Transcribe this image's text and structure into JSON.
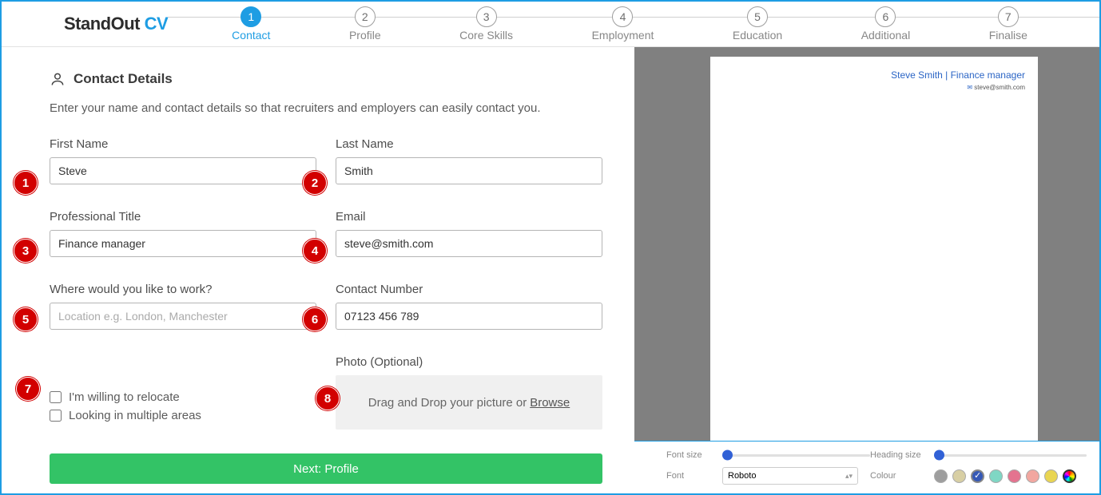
{
  "logo": {
    "part1": "StandOut ",
    "part2": "CV"
  },
  "steps": [
    {
      "num": "1",
      "label": "Contact",
      "active": true
    },
    {
      "num": "2",
      "label": "Profile"
    },
    {
      "num": "3",
      "label": "Core Skills"
    },
    {
      "num": "4",
      "label": "Employment"
    },
    {
      "num": "5",
      "label": "Education"
    },
    {
      "num": "6",
      "label": "Additional"
    },
    {
      "num": "7",
      "label": "Finalise"
    }
  ],
  "section": {
    "title": "Contact Details",
    "desc": "Enter your name and contact details so that recruiters and employers can easily contact you."
  },
  "fields": {
    "first_name": {
      "label": "First Name",
      "value": "Steve"
    },
    "last_name": {
      "label": "Last Name",
      "value": "Smith"
    },
    "title": {
      "label": "Professional Title",
      "value": "Finance manager"
    },
    "email": {
      "label": "Email",
      "value": "steve@smith.com"
    },
    "location": {
      "label": "Where would you like to work?",
      "placeholder": "Location e.g. London, Manchester",
      "value": ""
    },
    "phone": {
      "label": "Contact Number",
      "value": "07123 456 789"
    }
  },
  "checks": {
    "relocate": "I'm willing to relocate",
    "multiple": "Looking in multiple areas"
  },
  "photo": {
    "label": "Photo (Optional)",
    "drop_text": "Drag and Drop your picture or ",
    "browse": "Browse"
  },
  "next_button": "Next: Profile",
  "badges": [
    "1",
    "2",
    "3",
    "4",
    "5",
    "6",
    "7",
    "8"
  ],
  "preview": {
    "name_title": "Steve Smith | Finance manager",
    "email": "steve@smith.com"
  },
  "style_panel": {
    "font_size_label": "Font size",
    "heading_size_label": "Heading size",
    "font_label": "Font",
    "font_value": "Roboto",
    "colour_label": "Colour",
    "swatches": [
      "#9e9e9e",
      "#d8cfa4",
      "#3558b6",
      "#7fd7c4",
      "#e4738f",
      "#f2a7a0",
      "#e9d552",
      "multi"
    ],
    "selected_swatch": 2
  }
}
